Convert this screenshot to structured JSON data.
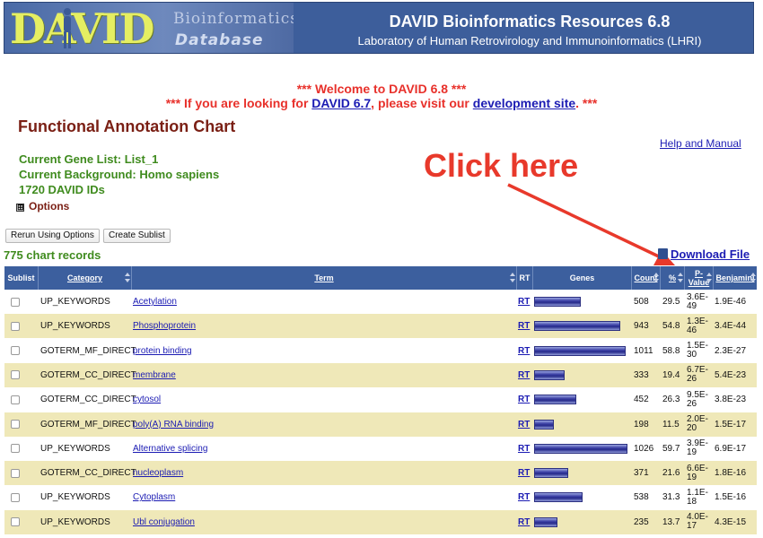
{
  "banner": {
    "logo_text": "DAVID",
    "logo_sub1": "Bioinformatics",
    "logo_sub2": "Database",
    "title": "DAVID Bioinformatics Resources 6.8",
    "subtitle": "Laboratory of Human Retrovirology and Immunoinformatics (LHRI)"
  },
  "welcome": {
    "line1": "*** Welcome to DAVID 6.8 ***",
    "line2_pre": "*** If you are looking for ",
    "line2_link1": "DAVID 6.7",
    "line2_mid": ", please visit our ",
    "line2_link2": "development site",
    "line2_post": ". ***"
  },
  "page_title": "Functional Annotation Chart",
  "help_link": "Help and Manual",
  "gene_list": "Current Gene List: List_1",
  "background": "Current Background: Homo sapiens",
  "ids": "1720 DAVID IDs",
  "options": {
    "box": "⊞",
    "label": "Options"
  },
  "buttons": {
    "rerun": "Rerun Using Options",
    "sublist": "Create Sublist"
  },
  "records": "775 chart records",
  "annotation": {
    "text": "Click here",
    "color": "#e8392b"
  },
  "download_label": "Download File",
  "table": {
    "headers": {
      "sublist": "Sublist",
      "category": "Category",
      "term": "Term",
      "rt": "RT",
      "genes": "Genes",
      "count": "Count",
      "percent": "%",
      "pvalue_1": "P-",
      "pvalue_2": "Value",
      "benjamini": "Benjamini"
    },
    "rows": [
      {
        "category": "UP_KEYWORDS",
        "term": "Acetylation",
        "rt": "RT",
        "count": "508",
        "percent": "29.5",
        "pv1": "3.6E-",
        "pv2": "49",
        "benjamini": "1.9E-46",
        "bar": 0.5
      },
      {
        "category": "UP_KEYWORDS",
        "term": "Phosphoprotein",
        "rt": "RT",
        "count": "943",
        "percent": "54.8",
        "pv1": "1.3E-",
        "pv2": "46",
        "benjamini": "3.4E-44",
        "bar": 0.92
      },
      {
        "category": "GOTERM_MF_DIRECT",
        "term": "protein binding",
        "rt": "RT",
        "count": "1011",
        "percent": "58.8",
        "pv1": "1.5E-",
        "pv2": "30",
        "benjamini": "2.3E-27",
        "bar": 0.98
      },
      {
        "category": "GOTERM_CC_DIRECT",
        "term": "membrane",
        "rt": "RT",
        "count": "333",
        "percent": "19.4",
        "pv1": "6.7E-",
        "pv2": "26",
        "benjamini": "5.4E-23",
        "bar": 0.33
      },
      {
        "category": "GOTERM_CC_DIRECT",
        "term": "cytosol",
        "rt": "RT",
        "count": "452",
        "percent": "26.3",
        "pv1": "9.5E-",
        "pv2": "26",
        "benjamini": "3.8E-23",
        "bar": 0.45
      },
      {
        "category": "GOTERM_MF_DIRECT",
        "term": "poly(A) RNA binding",
        "rt": "RT",
        "count": "198",
        "percent": "11.5",
        "pv1": "2.0E-",
        "pv2": "20",
        "benjamini": "1.5E-17",
        "bar": 0.21
      },
      {
        "category": "UP_KEYWORDS",
        "term": "Alternative splicing",
        "rt": "RT",
        "count": "1026",
        "percent": "59.7",
        "pv1": "3.9E-",
        "pv2": "19",
        "benjamini": "6.9E-17",
        "bar": 1.0
      },
      {
        "category": "GOTERM_CC_DIRECT",
        "term": "nucleoplasm",
        "rt": "RT",
        "count": "371",
        "percent": "21.6",
        "pv1": "6.6E-",
        "pv2": "19",
        "benjamini": "1.8E-16",
        "bar": 0.37
      },
      {
        "category": "UP_KEYWORDS",
        "term": "Cytoplasm",
        "rt": "RT",
        "count": "538",
        "percent": "31.3",
        "pv1": "1.1E-",
        "pv2": "18",
        "benjamini": "1.5E-16",
        "bar": 0.52
      },
      {
        "category": "UP_KEYWORDS",
        "term": "Ubl conjugation",
        "rt": "RT",
        "count": "235",
        "percent": "13.7",
        "pv1": "4.0E-",
        "pv2": "17",
        "benjamini": "4.3E-15",
        "bar": 0.25
      }
    ]
  }
}
